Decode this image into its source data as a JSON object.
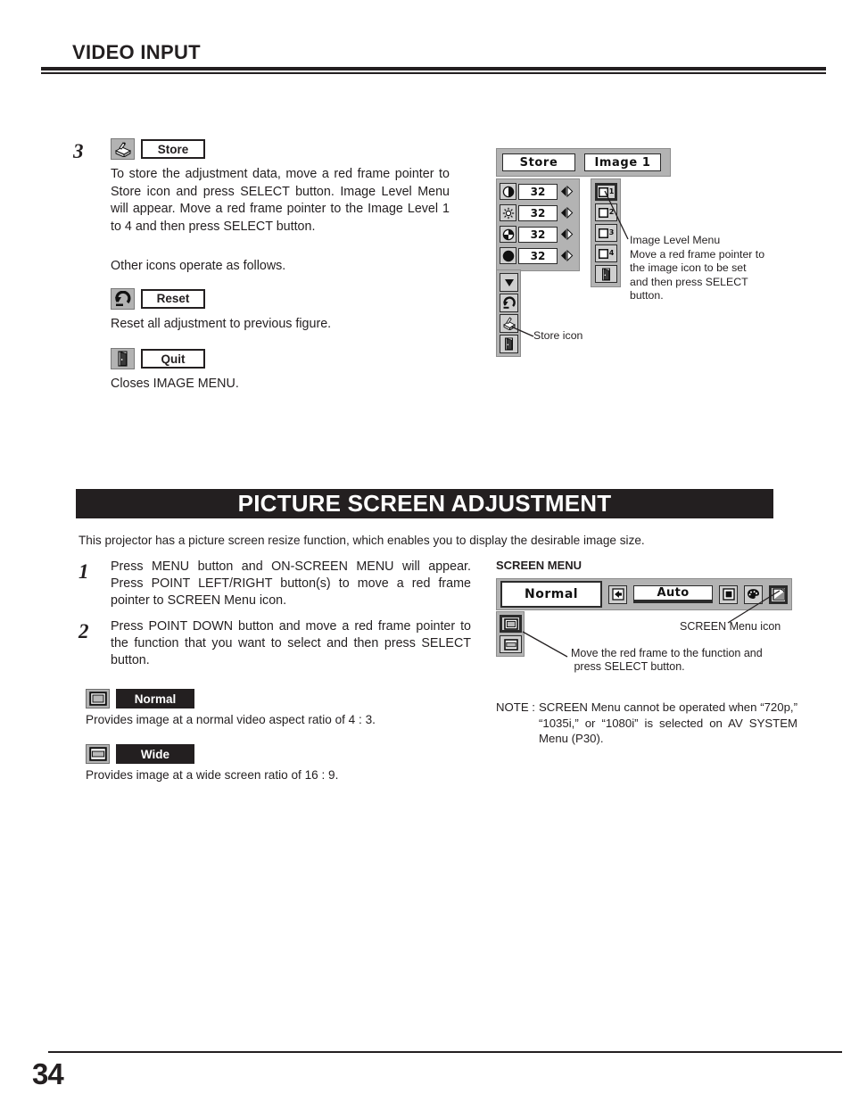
{
  "header": {
    "title": "VIDEO INPUT"
  },
  "step3": {
    "number": "3",
    "store_icon": "store-disk-icon",
    "store_label": "Store",
    "store_body": "To store the adjustment data, move a red frame pointer to Store icon and press SELECT button.  Image Level Menu will appear.  Move a red frame pointer to the Image Level 1 to 4 and then press SELECT button.",
    "other_icons_note": "Other icons operate as follows.",
    "reset_icon": "reset-undo-icon",
    "reset_label": "Reset",
    "reset_body": "Reset all adjustment to previous figure.",
    "quit_icon": "quit-door-icon",
    "quit_label": "Quit",
    "quit_body": "Closes IMAGE MENU."
  },
  "image_menu_osd": {
    "title_store": "Store",
    "title_image": "Image 1",
    "rows": [
      {
        "icon": "contrast-icon",
        "value": "32",
        "arrows": "left-right-arrows-icon"
      },
      {
        "icon": "brightness-sun-icon",
        "value": "32",
        "arrows": "left-right-arrows-icon"
      },
      {
        "icon": "color-icon",
        "value": "32",
        "arrows": "left-right-arrows-icon"
      },
      {
        "icon": "tint-icon",
        "value": "32",
        "arrows": "left-right-arrows-icon"
      }
    ],
    "stack_icons": [
      "down-arrow-icon",
      "reset-undo-icon",
      "store-disk-icon",
      "quit-door-icon"
    ],
    "levels": [
      {
        "num": "1",
        "selected": true
      },
      {
        "num": "2",
        "selected": false
      },
      {
        "num": "3",
        "selected": false
      },
      {
        "num": "4",
        "selected": false
      }
    ],
    "level_quit_icon": "quit-door-icon",
    "annotation_image_level": "Image Level Menu\nMove a red frame pointer to the image icon to be set and then press SELECT button.",
    "annotation_store_icon": "Store icon"
  },
  "section": {
    "banner_title": "PICTURE SCREEN ADJUSTMENT",
    "intro": "This projector has a picture screen resize function, which enables you to display the desirable image size."
  },
  "steps": [
    {
      "number": "1",
      "text": "Press MENU button and ON-SCREEN MENU will appear.  Press POINT LEFT/RIGHT button(s) to move a red frame pointer to SCREEN Menu icon."
    },
    {
      "number": "2",
      "text": "Press POINT DOWN button and move a red frame pointer to the function that you want to select and then press SELECT button."
    }
  ],
  "modes": [
    {
      "icon": "normal-screen-icon",
      "label": "Normal",
      "desc": "Provides image at a normal video aspect ratio of 4 : 3."
    },
    {
      "icon": "wide-screen-icon",
      "label": "Wide",
      "desc": "Provides image at a wide screen ratio of 16 : 9."
    }
  ],
  "screen_menu": {
    "heading": "SCREEN MENU",
    "current_mode": "Normal",
    "input_icon": "input-arrow-icon",
    "auto_value": "Auto",
    "bar_icons": [
      "image-square-icon",
      "color-palette-icon",
      "screen-corner-icon"
    ],
    "sub_items": [
      {
        "icon": "normal-screen-icon",
        "selected": true
      },
      {
        "icon": "wide-screen-icon",
        "selected": false
      }
    ],
    "annotation_screen_icon": "SCREEN Menu icon",
    "annotation_move_frame": "Move the red frame to the function and press SELECT button."
  },
  "note": {
    "label": "NOTE :",
    "body": "SCREEN Menu cannot be operated when “720p,” “1035i,” or “1080i” is selected on AV SYSTEM Menu (P30)."
  },
  "footer": {
    "page_number": "34"
  }
}
